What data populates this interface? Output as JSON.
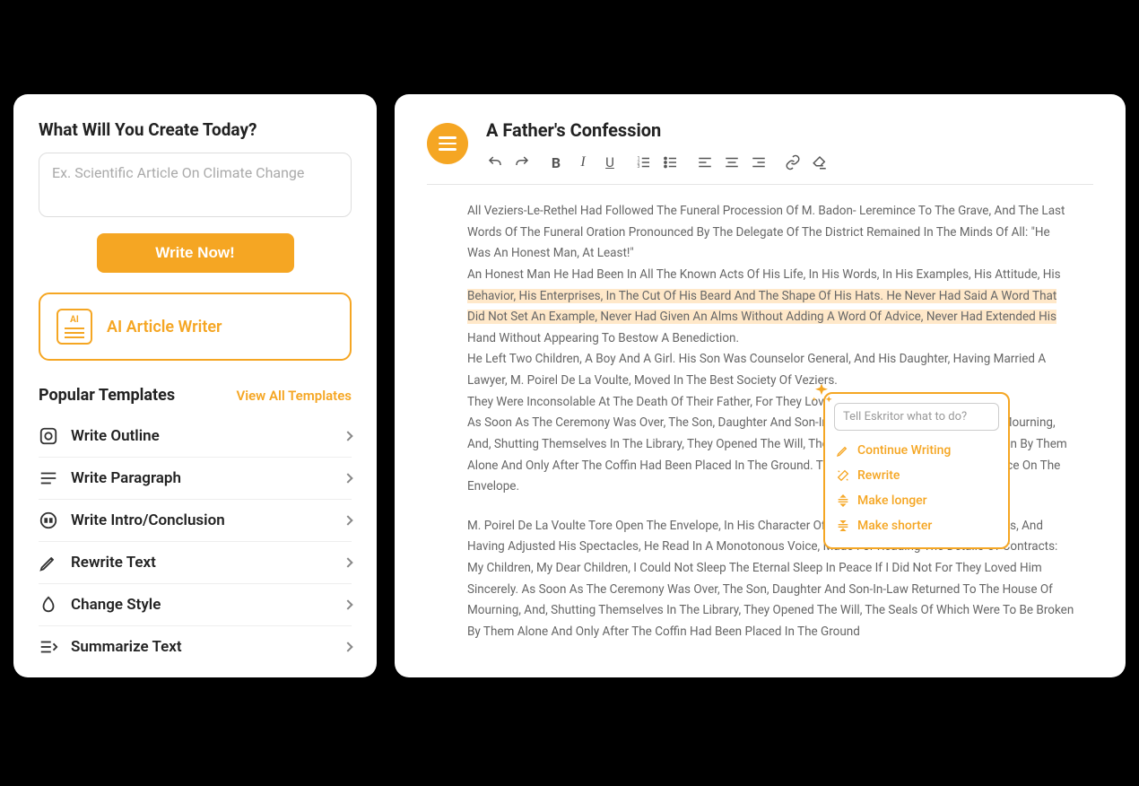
{
  "left": {
    "heading": "What Will You Create Today?",
    "input_placeholder": "Ex. Scientific Article On Climate Change",
    "write_now": "Write Now!",
    "ai_writer_label": "AI Article Writer",
    "templates_title": "Popular Templates",
    "view_all": "View All Templates",
    "templates": [
      {
        "label": "Write Outline"
      },
      {
        "label": "Write Paragraph"
      },
      {
        "label": "Write Intro/Conclusion"
      },
      {
        "label": "Rewrite Text"
      },
      {
        "label": "Change Style"
      },
      {
        "label": "Summarize Text"
      }
    ]
  },
  "right": {
    "title": "A Father's Confession",
    "para1": "All Veziers-Le-Rethel Had Followed The Funeral Procession Of M. Badon- Leremince To The Grave, And The Last Words Of The Funeral Oration Pronounced By The Delegate Of The District Remained In The Minds Of All: \"He Was An Honest Man, At Least!\"",
    "para2_a": "An Honest Man He Had Been In All The Known Acts Of His Life, In His Words, In His Examples, His Attitude, His ",
    "para2_hl": "Behavior, His Enterprises, In The Cut Of His Beard And The Shape Of His Hats. He Never Had Said A Word That Did Not Set An Example, Never Had Given An Alms Without Adding A Word Of Advice, Never Had Extended His",
    "para2_b": " Hand Without Appearing To Bestow A Benediction.",
    "para3": "He Left Two Children, A Boy And A Girl. His Son Was Counselor General, And His Daughter, Having Married A Lawyer, M. Poirel De La Voulte, Moved In The Best Society Of Veziers.",
    "para4": "They Were Inconsolable At The Death Of Their Father, For They Loved Him Sincerely.",
    "para5": "As Soon As The Ceremony Was Over, The Son, Daughter And Son-In-Law Returned To The House Of Mourning, And, Shutting Themselves In The Library, They Opened The Will, The Seals Of Which Were To Be Broken By Them Alone And Only After The Coffin Had Been Placed In The Ground. This Wish Was Expressed By A Notice On The Envelope.",
    "para6": "M. Poirel De La Voulte Tore Open The Envelope, In His Character Of A Lawyer Used To Such Operations, And Having Adjusted His Spectacles, He Read In A Monotonous Voice, Made For Reading The Details Of Contracts: My Children, My Dear Children, I Could Not Sleep The Eternal Sleep In Peace If I Did Not For They Loved Him Sincerely. As Soon As The Ceremony Was Over, The Son, Daughter And Son-In-Law Returned To The House Of Mourning, And, Shutting Themselves In The Library, They Opened The Will, The Seals Of Which Were To Be Broken By Them Alone And Only After The Coffin Had Been Placed In The Ground"
  },
  "popup": {
    "placeholder": "Tell Eskritor what to do?",
    "actions": [
      {
        "label": "Continue Writing"
      },
      {
        "label": "Rewrite"
      },
      {
        "label": "Make longer"
      },
      {
        "label": "Make shorter"
      }
    ]
  }
}
